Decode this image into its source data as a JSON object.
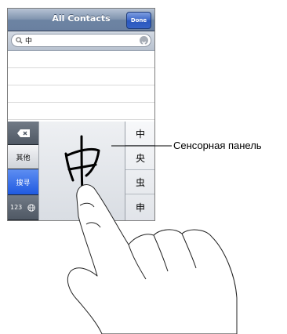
{
  "navbar": {
    "title": "All Contacts",
    "done_label": "Done"
  },
  "search": {
    "value": "中"
  },
  "keyboard": {
    "other_label": "其他",
    "search_label": "搜寻",
    "numbers_label": "123",
    "candidates": [
      "中",
      "央",
      "虫",
      "申"
    ]
  },
  "callout": {
    "label": "Сенсорная панель"
  },
  "icons": {
    "search": "search-icon",
    "clear": "clear-icon",
    "backspace": "backspace-icon",
    "globe": "globe-icon"
  }
}
